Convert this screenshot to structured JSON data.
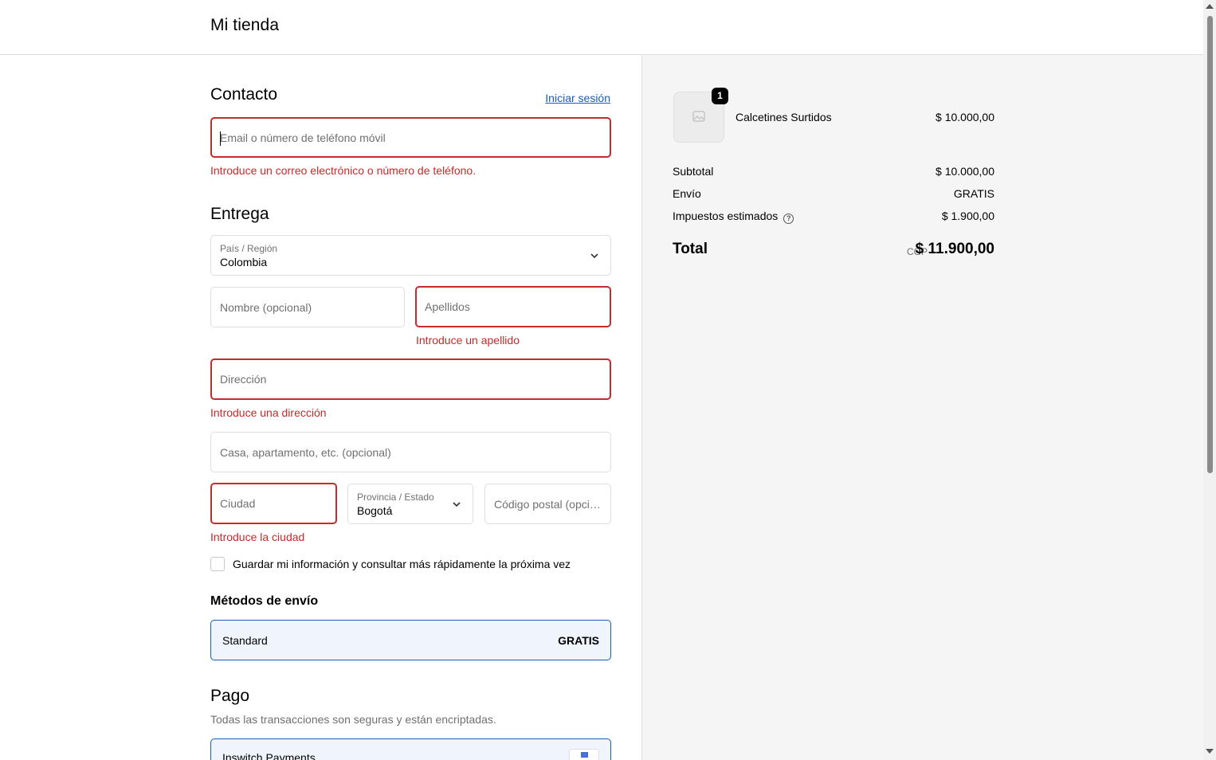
{
  "header": {
    "store_name": "Mi tienda"
  },
  "contact": {
    "title": "Contacto",
    "login_link": "Iniciar sesión",
    "email_placeholder": "Email o número de teléfono móvil",
    "email_error": "Introduce un correo electrónico o número de teléfono."
  },
  "delivery": {
    "title": "Entrega",
    "country_label": "País / Región",
    "country_value": "Colombia",
    "first_name_placeholder": "Nombre (opcional)",
    "last_name_placeholder": "Apellidos",
    "last_name_error": "Introduce un apellido",
    "address_placeholder": "Dirección",
    "address_error": "Introduce una dirección",
    "apartment_placeholder": "Casa, apartamento, etc. (opcional)",
    "city_placeholder": "Ciudad",
    "city_error": "Introduce la ciudad",
    "province_label": "Provincia / Estado",
    "province_value": "Bogotá",
    "postal_placeholder": "Código postal (opcional)",
    "save_info_label": "Guardar mi información y consultar más rápidamente la próxima vez"
  },
  "shipping": {
    "title": "Métodos de envío",
    "method_name": "Standard",
    "method_price": "GRATIS"
  },
  "payment": {
    "title": "Pago",
    "subtitle": "Todas las transacciones son seguras y están encriptadas.",
    "provider": "Inswitch Payments"
  },
  "summary": {
    "product_name": "Calcetines Surtidos",
    "product_qty": "1",
    "product_price": "$ 10.000,00",
    "subtotal_label": "Subtotal",
    "subtotal_value": "$ 10.000,00",
    "shipping_label": "Envío",
    "shipping_value": "GRATIS",
    "taxes_label": "Impuestos estimados",
    "taxes_value": "$ 1.900,00",
    "total_label": "Total",
    "total_currency": "COP",
    "total_value": "$ 11.900,00"
  },
  "colors": {
    "error": "#c62a2a",
    "accent": "#1a5db6",
    "summary_bg": "#f5f5f5"
  }
}
